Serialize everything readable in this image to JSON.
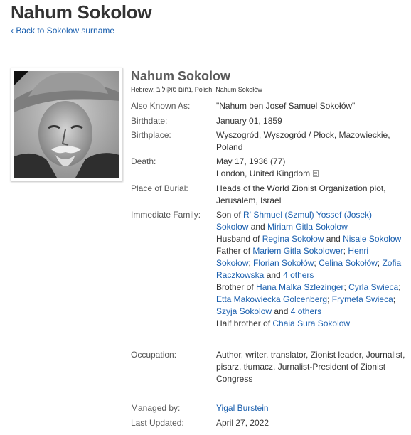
{
  "page": {
    "title": "Nahum Sokolow",
    "back_link": "‹ Back to Sokolow surname"
  },
  "profile": {
    "name": "Nahum Sokolow",
    "also_names": "Hebrew: נחום סוקולוב, Polish: Nahum Sokołów",
    "labels": {
      "aka": "Also Known As:",
      "birthdate": "Birthdate:",
      "birthplace": "Birthplace:",
      "death": "Death:",
      "burial": "Place of Burial:",
      "family": "Immediate Family:",
      "occupation": "Occupation:",
      "managed_by": "Managed by:",
      "last_updated": "Last Updated:"
    },
    "aka": "\"Nahum ben Josef Samuel Sokołów\"",
    "birthdate": "January 01, 1859",
    "birthplace": "Wyszogród, Wyszogród / Płock, Mazowieckie, Poland",
    "death_date": "May 17, 1936 (77)",
    "death_place": "London, United Kingdom",
    "burial": "Heads of the World Zionist Organization plot, Jerusalem, Israel",
    "occupation": "Author, writer, translator, Zionist leader, Journalist, pisarz, tłumacz, Jurnalist-President of Zionist Congress",
    "managed_by": "Yigal Burstein",
    "last_updated": "April 27, 2022"
  },
  "family": {
    "son_of": "Son of ",
    "father": "R' Shmuel (Szmul) Yossef (Josek) Sokolow",
    "and1": " and ",
    "mother": "Miriam Gitla Sokolow",
    "husband_of": "Husband of ",
    "wife1": "Regina Sokołow",
    "and2": " and ",
    "wife2": "Nisale Sokolow",
    "father_of": "Father of ",
    "children": [
      "Mariem Gitla Sokolower",
      "Henri Sokołow",
      "Florian Sokołów",
      "Celina Sokołów",
      "Zofia Raczkowska"
    ],
    "sep": "; ",
    "and3": " and ",
    "children_more": "4 others",
    "brother_of": "Brother of ",
    "siblings": [
      "Hana Malka Szlezinger",
      "Cyrla Swieca",
      "Etta Makowiecka Golcenberg",
      "Frymeta Swieca",
      "Szyja Sokolow"
    ],
    "and4": " and ",
    "siblings_more": "4 others",
    "half_brother_of": "Half brother of ",
    "half_sibling": "Chaia Sura Sokolow"
  },
  "icons": {
    "source": "source-document-icon"
  }
}
